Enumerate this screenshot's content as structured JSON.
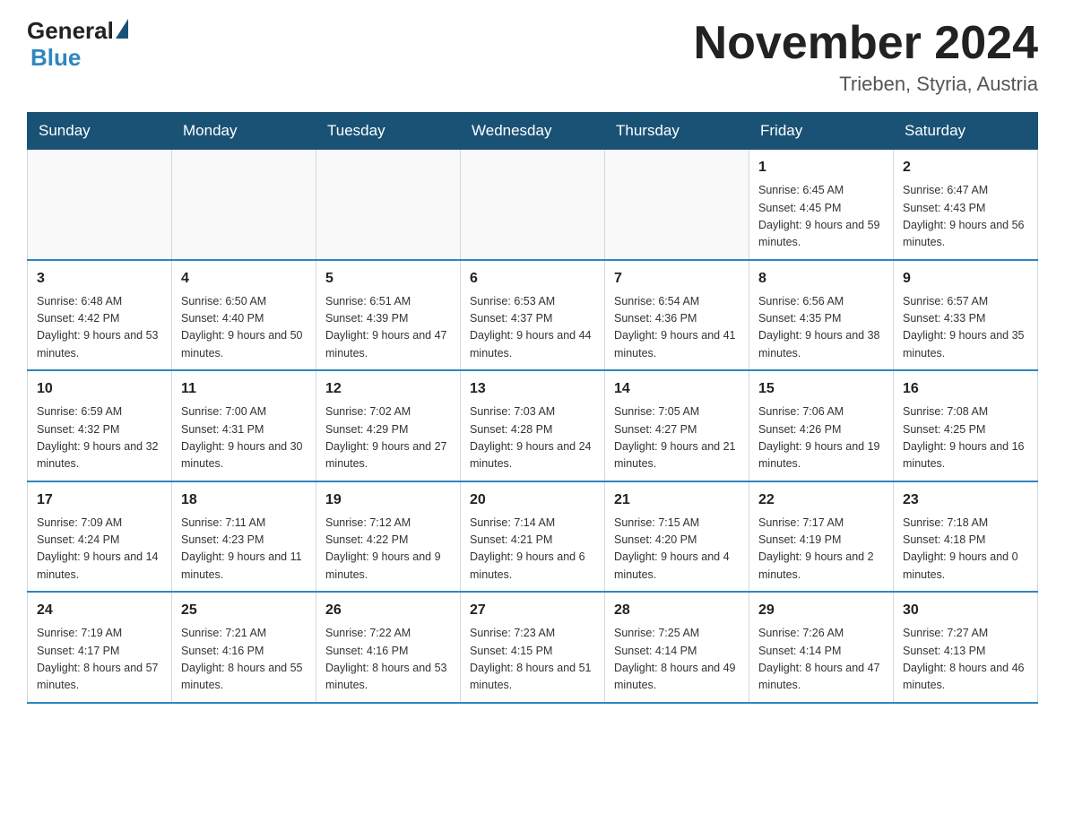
{
  "header": {
    "logo_general": "General",
    "logo_blue": "Blue",
    "month_year": "November 2024",
    "location": "Trieben, Styria, Austria"
  },
  "weekdays": [
    "Sunday",
    "Monday",
    "Tuesday",
    "Wednesday",
    "Thursday",
    "Friday",
    "Saturday"
  ],
  "weeks": [
    [
      {
        "day": "",
        "sunrise": "",
        "sunset": "",
        "daylight": ""
      },
      {
        "day": "",
        "sunrise": "",
        "sunset": "",
        "daylight": ""
      },
      {
        "day": "",
        "sunrise": "",
        "sunset": "",
        "daylight": ""
      },
      {
        "day": "",
        "sunrise": "",
        "sunset": "",
        "daylight": ""
      },
      {
        "day": "",
        "sunrise": "",
        "sunset": "",
        "daylight": ""
      },
      {
        "day": "1",
        "sunrise": "Sunrise: 6:45 AM",
        "sunset": "Sunset: 4:45 PM",
        "daylight": "Daylight: 9 hours and 59 minutes."
      },
      {
        "day": "2",
        "sunrise": "Sunrise: 6:47 AM",
        "sunset": "Sunset: 4:43 PM",
        "daylight": "Daylight: 9 hours and 56 minutes."
      }
    ],
    [
      {
        "day": "3",
        "sunrise": "Sunrise: 6:48 AM",
        "sunset": "Sunset: 4:42 PM",
        "daylight": "Daylight: 9 hours and 53 minutes."
      },
      {
        "day": "4",
        "sunrise": "Sunrise: 6:50 AM",
        "sunset": "Sunset: 4:40 PM",
        "daylight": "Daylight: 9 hours and 50 minutes."
      },
      {
        "day": "5",
        "sunrise": "Sunrise: 6:51 AM",
        "sunset": "Sunset: 4:39 PM",
        "daylight": "Daylight: 9 hours and 47 minutes."
      },
      {
        "day": "6",
        "sunrise": "Sunrise: 6:53 AM",
        "sunset": "Sunset: 4:37 PM",
        "daylight": "Daylight: 9 hours and 44 minutes."
      },
      {
        "day": "7",
        "sunrise": "Sunrise: 6:54 AM",
        "sunset": "Sunset: 4:36 PM",
        "daylight": "Daylight: 9 hours and 41 minutes."
      },
      {
        "day": "8",
        "sunrise": "Sunrise: 6:56 AM",
        "sunset": "Sunset: 4:35 PM",
        "daylight": "Daylight: 9 hours and 38 minutes."
      },
      {
        "day": "9",
        "sunrise": "Sunrise: 6:57 AM",
        "sunset": "Sunset: 4:33 PM",
        "daylight": "Daylight: 9 hours and 35 minutes."
      }
    ],
    [
      {
        "day": "10",
        "sunrise": "Sunrise: 6:59 AM",
        "sunset": "Sunset: 4:32 PM",
        "daylight": "Daylight: 9 hours and 32 minutes."
      },
      {
        "day": "11",
        "sunrise": "Sunrise: 7:00 AM",
        "sunset": "Sunset: 4:31 PM",
        "daylight": "Daylight: 9 hours and 30 minutes."
      },
      {
        "day": "12",
        "sunrise": "Sunrise: 7:02 AM",
        "sunset": "Sunset: 4:29 PM",
        "daylight": "Daylight: 9 hours and 27 minutes."
      },
      {
        "day": "13",
        "sunrise": "Sunrise: 7:03 AM",
        "sunset": "Sunset: 4:28 PM",
        "daylight": "Daylight: 9 hours and 24 minutes."
      },
      {
        "day": "14",
        "sunrise": "Sunrise: 7:05 AM",
        "sunset": "Sunset: 4:27 PM",
        "daylight": "Daylight: 9 hours and 21 minutes."
      },
      {
        "day": "15",
        "sunrise": "Sunrise: 7:06 AM",
        "sunset": "Sunset: 4:26 PM",
        "daylight": "Daylight: 9 hours and 19 minutes."
      },
      {
        "day": "16",
        "sunrise": "Sunrise: 7:08 AM",
        "sunset": "Sunset: 4:25 PM",
        "daylight": "Daylight: 9 hours and 16 minutes."
      }
    ],
    [
      {
        "day": "17",
        "sunrise": "Sunrise: 7:09 AM",
        "sunset": "Sunset: 4:24 PM",
        "daylight": "Daylight: 9 hours and 14 minutes."
      },
      {
        "day": "18",
        "sunrise": "Sunrise: 7:11 AM",
        "sunset": "Sunset: 4:23 PM",
        "daylight": "Daylight: 9 hours and 11 minutes."
      },
      {
        "day": "19",
        "sunrise": "Sunrise: 7:12 AM",
        "sunset": "Sunset: 4:22 PM",
        "daylight": "Daylight: 9 hours and 9 minutes."
      },
      {
        "day": "20",
        "sunrise": "Sunrise: 7:14 AM",
        "sunset": "Sunset: 4:21 PM",
        "daylight": "Daylight: 9 hours and 6 minutes."
      },
      {
        "day": "21",
        "sunrise": "Sunrise: 7:15 AM",
        "sunset": "Sunset: 4:20 PM",
        "daylight": "Daylight: 9 hours and 4 minutes."
      },
      {
        "day": "22",
        "sunrise": "Sunrise: 7:17 AM",
        "sunset": "Sunset: 4:19 PM",
        "daylight": "Daylight: 9 hours and 2 minutes."
      },
      {
        "day": "23",
        "sunrise": "Sunrise: 7:18 AM",
        "sunset": "Sunset: 4:18 PM",
        "daylight": "Daylight: 9 hours and 0 minutes."
      }
    ],
    [
      {
        "day": "24",
        "sunrise": "Sunrise: 7:19 AM",
        "sunset": "Sunset: 4:17 PM",
        "daylight": "Daylight: 8 hours and 57 minutes."
      },
      {
        "day": "25",
        "sunrise": "Sunrise: 7:21 AM",
        "sunset": "Sunset: 4:16 PM",
        "daylight": "Daylight: 8 hours and 55 minutes."
      },
      {
        "day": "26",
        "sunrise": "Sunrise: 7:22 AM",
        "sunset": "Sunset: 4:16 PM",
        "daylight": "Daylight: 8 hours and 53 minutes."
      },
      {
        "day": "27",
        "sunrise": "Sunrise: 7:23 AM",
        "sunset": "Sunset: 4:15 PM",
        "daylight": "Daylight: 8 hours and 51 minutes."
      },
      {
        "day": "28",
        "sunrise": "Sunrise: 7:25 AM",
        "sunset": "Sunset: 4:14 PM",
        "daylight": "Daylight: 8 hours and 49 minutes."
      },
      {
        "day": "29",
        "sunrise": "Sunrise: 7:26 AM",
        "sunset": "Sunset: 4:14 PM",
        "daylight": "Daylight: 8 hours and 47 minutes."
      },
      {
        "day": "30",
        "sunrise": "Sunrise: 7:27 AM",
        "sunset": "Sunset: 4:13 PM",
        "daylight": "Daylight: 8 hours and 46 minutes."
      }
    ]
  ]
}
